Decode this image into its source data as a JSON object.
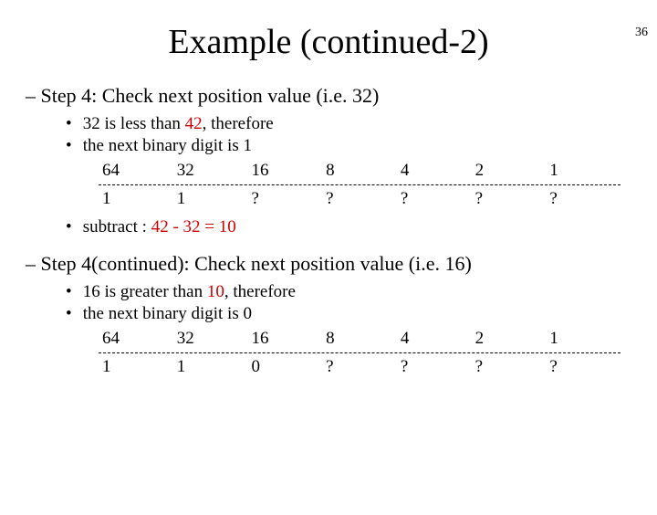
{
  "page_number": "36",
  "title": "Example (continued-2)",
  "sections": [
    {
      "heading_prefix": "– ",
      "heading": "Step 4: Check next position value (i.e. 32)",
      "bullets": {
        "b1_pre": "32 is less than ",
        "b1_hl": "42",
        "b1_post": ", therefore",
        "b2": "the next binary digit is 1"
      },
      "table": {
        "headers": [
          "64",
          "32",
          "16",
          "8",
          "4",
          "2",
          "1"
        ],
        "values": [
          "1",
          "1",
          "?",
          "?",
          "?",
          "?",
          "?"
        ]
      },
      "sub_pre": "subtract : ",
      "sub_eq": "42 - 32 = 10"
    },
    {
      "heading_prefix": "– ",
      "heading": "Step 4(continued): Check next position value (i.e. 16)",
      "bullets": {
        "b1_pre": "16 is greater than ",
        "b1_hl": "10",
        "b1_post": ", therefore",
        "b2": "the next binary digit is 0"
      },
      "table": {
        "headers": [
          "64",
          "32",
          "16",
          "8",
          "4",
          "2",
          "1"
        ],
        "values": [
          "1",
          "1",
          "0",
          "?",
          "?",
          "?",
          "?"
        ]
      }
    }
  ]
}
